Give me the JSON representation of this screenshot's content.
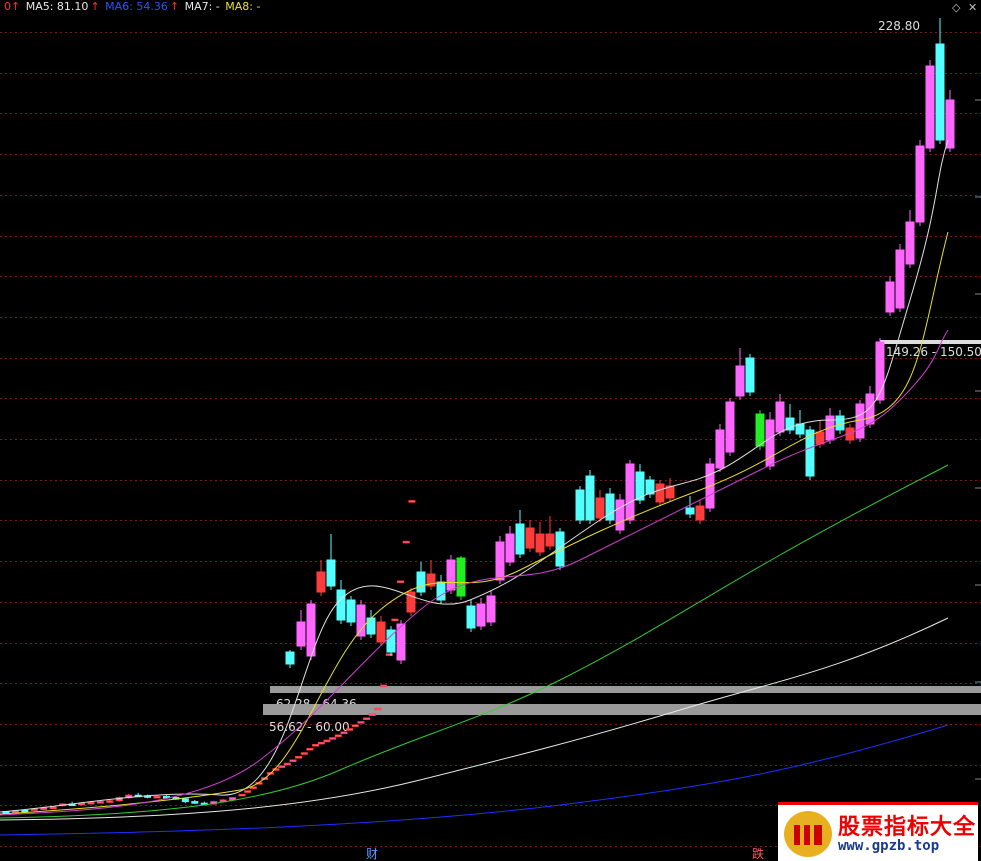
{
  "header": {
    "ma5_label": "MA5: 81.10",
    "ma6_label": "MA6: 54.36",
    "ma7_label": "MA7: -",
    "ma8_label": "MA8: -",
    "arrow": "↑"
  },
  "colors": {
    "up": "#ff3c3c",
    "down": "#54ffff",
    "up_fill_pink": "#ff66ff",
    "limit_green": "#22ee22",
    "grid": "#7a1a1a"
  },
  "chart_data": {
    "type": "candlestick",
    "high_label": "228.80",
    "zones": [
      {
        "label": "149.26 - 150.50"
      },
      {
        "label": "62.28 - 64.36"
      },
      {
        "label": "56.62 - 60.00"
      }
    ],
    "markers": [
      "财",
      "跌"
    ],
    "candles": [
      [
        3.55,
        3.6,
        3.5,
        3.5
      ],
      [
        3.6,
        3.7,
        3.55,
        3.6
      ],
      [
        3.7,
        3.8,
        3.6,
        3.65
      ],
      [
        3.8,
        4.0,
        3.7,
        3.9
      ],
      [
        4.0,
        4.1,
        3.9,
        4.0
      ],
      [
        4.0,
        4.2,
        3.9,
        4.1
      ],
      [
        4.3,
        4.6,
        4.2,
        4.5
      ],
      [
        4.5,
        4.8,
        4.3,
        4.4
      ],
      [
        4.4,
        4.7,
        4.3,
        4.6
      ],
      [
        4.6,
        4.9,
        4.5,
        4.7
      ],
      [
        4.7,
        5.0,
        4.6,
        4.8
      ],
      [
        4.8,
        5.1,
        4.7,
        4.9
      ],
      [
        4.9,
        5.6,
        4.8,
        5.4
      ],
      [
        5.4,
        6.0,
        5.2,
        5.8
      ],
      [
        5.8,
        6.2,
        5.5,
        5.7
      ],
      [
        5.7,
        5.9,
        5.3,
        5.5
      ],
      [
        5.5,
        5.8,
        5.3,
        5.6
      ],
      [
        5.6,
        5.8,
        5.2,
        5.4
      ],
      [
        5.4,
        5.6,
        5.0,
        5.2
      ],
      [
        5.2,
        5.4,
        4.6,
        4.8
      ],
      [
        4.8,
        5.0,
        4.5,
        4.6
      ],
      [
        4.6,
        4.8,
        4.3,
        4.5
      ],
      [
        4.5,
        4.9,
        4.4,
        4.8
      ],
      [
        4.8,
        5.2,
        4.7,
        5.0
      ],
      [
        5.0,
        5.4,
        4.9,
        5.4
      ],
      [
        5.94,
        5.94,
        5.94,
        5.94
      ],
      [
        6.53,
        6.53,
        6.53,
        6.53
      ],
      [
        7.18,
        7.18,
        7.18,
        7.18
      ],
      [
        7.9,
        7.9,
        7.9,
        7.9
      ],
      [
        8.69,
        8.69,
        8.69,
        8.69
      ],
      [
        9.56,
        9.56,
        9.56,
        9.56
      ],
      [
        10.5,
        10.5,
        10.5,
        10.5
      ],
      [
        11.6,
        11.6,
        11.6,
        11.6
      ],
      [
        12.7,
        12.7,
        12.7,
        12.7
      ],
      [
        14.0,
        14.0,
        14.0,
        14.0
      ],
      [
        15.4,
        15.4,
        15.4,
        15.4
      ],
      [
        16.9,
        16.9,
        16.9,
        16.9
      ],
      [
        18.6,
        18.6,
        18.6,
        18.6
      ],
      [
        20.5,
        20.5,
        20.5,
        20.5
      ],
      [
        22.6,
        22.6,
        22.6,
        22.6
      ],
      [
        24.8,
        24.8,
        24.8,
        24.8
      ],
      [
        27.3,
        27.3,
        27.3,
        27.3
      ],
      [
        30.0,
        30.0,
        30.0,
        30.0
      ],
      [
        33.0,
        33.0,
        33.0,
        33.0
      ],
      [
        36.3,
        36.3,
        36.3,
        36.3
      ],
      [
        40.0,
        40.0,
        40.0,
        40.0
      ],
      [
        44.0,
        44.0,
        44.0,
        44.0
      ],
      [
        48.4,
        48.4,
        48.4,
        48.4
      ],
      [
        53.2,
        53.2,
        53.2,
        53.2
      ],
      [
        58.5,
        58.5,
        58.5,
        58.5
      ],
      [
        64.4,
        64.4,
        64.4,
        64.4
      ],
      [
        70.8,
        70.8,
        70.8,
        70.8
      ],
      [
        77.9,
        77.9,
        77.9,
        77.9
      ],
      [
        85.7,
        85.7,
        85.7,
        85.7
      ],
      [
        94.3,
        94.3,
        94.3,
        94.3
      ],
      [
        103.7,
        103.7,
        103.7,
        103.7
      ]
    ]
  }
}
